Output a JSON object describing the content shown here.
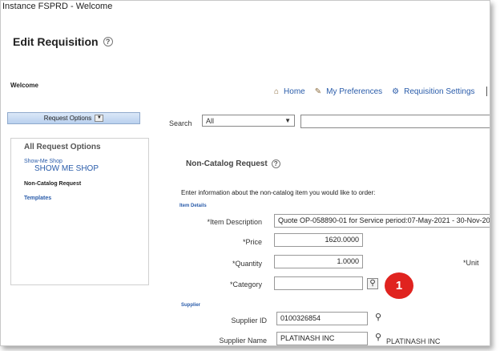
{
  "window": {
    "title": "Instance FSPRD - Welcome"
  },
  "header": {
    "page_title": "Edit Requisition",
    "welcome": "Welcome"
  },
  "topnav": {
    "home": "Home",
    "preferences": "My Preferences",
    "settings": "Requisition Settings"
  },
  "request_options": {
    "label": "Request Options"
  },
  "search": {
    "label": "Search",
    "selected": "All",
    "value": ""
  },
  "left_panel": {
    "title": "All Request Options",
    "show_me_shop_small": "Show-Me Shop",
    "show_me_shop_large": "SHOW ME SHOP",
    "non_catalog_request": "Non-Catalog Request",
    "templates": "Templates"
  },
  "form": {
    "title": "Non-Catalog Request",
    "instructions": "Enter information about the non-catalog item you would like to order:",
    "item_details_label": "Item Details",
    "item_description_label": "*Item Description",
    "item_description_value": "Quote OP-058890-01 for Service period:07-May-2021 - 30-Nov-20",
    "price_label": "*Price",
    "price_value": "1620.0000",
    "quantity_label": "*Quantity",
    "quantity_value": "1.0000",
    "unit_label": "*Unit",
    "category_label": "*Category",
    "category_value": "",
    "supplier_section_label": "Supplier",
    "supplier_id_label": "Supplier ID",
    "supplier_id_value": "0100326854",
    "supplier_name_label": "Supplier Name",
    "supplier_name_value": "PLATINASH INC",
    "supplier_name_display": "PLATINASH INC"
  },
  "callout": {
    "number": "1",
    "color": "#e0231f"
  }
}
